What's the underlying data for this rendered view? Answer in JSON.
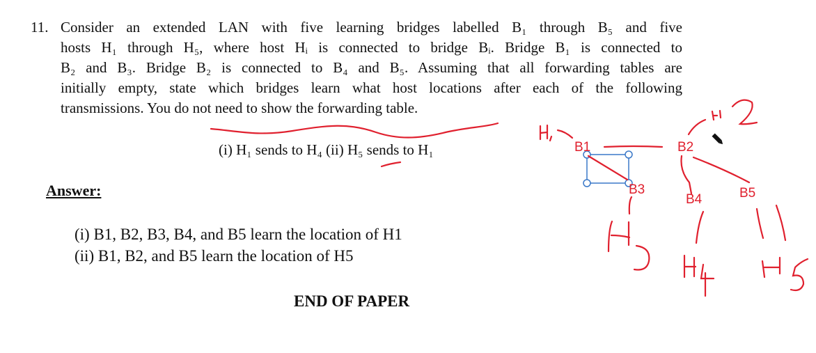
{
  "question": {
    "number": "11.",
    "lines": [
      "Consider an extended LAN with five learning bridges labelled B₁ through B₅ and five",
      "hosts H₁ through H₅, where host Hᵢ is connected to bridge Bᵢ.  Bridge B₁ is connected to",
      "B₂ and B₃. Bridge B₂ is connected to B₄ and B₅. Assuming that all forwarding tables are",
      "initially empty, state which bridges learn what host locations after each of the following",
      "transmissions. You do not need to show the forwarding table."
    ],
    "parts": "(i) H₁ sends to H₄  (ii) H₅ sends to H₁"
  },
  "answer": {
    "label": "Answer:",
    "lines": [
      "(i) B1, B2, B3, B4, and B5 learn the location of H1",
      "(ii) B1, B2, and B5 learn the location of H5"
    ]
  },
  "footer": "END OF PAPER",
  "diagram": {
    "bridges": [
      "B1",
      "B2",
      "B3",
      "B4",
      "B5"
    ],
    "handwritten_hosts": [
      "H1",
      "H2",
      "H3",
      "H4",
      "H5"
    ],
    "ink_color": "#e0202e",
    "selection_color": "#3a78c8",
    "cursor": "pen-icon"
  }
}
